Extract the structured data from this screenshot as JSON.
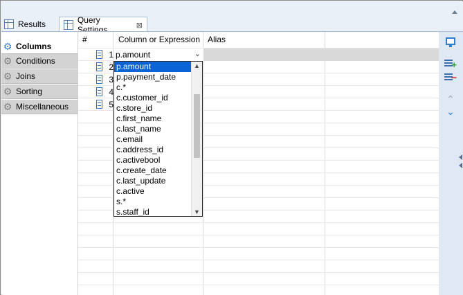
{
  "tabs": {
    "results_label": "Results",
    "query_settings_label": "Query Settings",
    "query_settings_close": "⊠"
  },
  "leftnav": {
    "items": [
      {
        "label": "Columns",
        "active": true
      },
      {
        "label": "Conditions",
        "active": false
      },
      {
        "label": "Joins",
        "active": false
      },
      {
        "label": "Sorting",
        "active": false
      },
      {
        "label": "Miscellaneous",
        "active": false
      }
    ]
  },
  "table": {
    "headers": {
      "num": "#",
      "column": "Column or Expression",
      "alias": "Alias"
    },
    "rows": [
      {
        "num": "1",
        "column": "p.amount",
        "alias": ""
      },
      {
        "num": "2",
        "column": "",
        "alias": ""
      },
      {
        "num": "3",
        "column": "",
        "alias": ""
      },
      {
        "num": "4",
        "column": "",
        "alias": ""
      },
      {
        "num": "5",
        "column": "",
        "alias": ""
      }
    ]
  },
  "dropdown": {
    "selected": "p.amount",
    "options": [
      "p.amount",
      "p.payment_date",
      "c.*",
      "c.customer_id",
      "c.store_id",
      "c.first_name",
      "c.last_name",
      "c.email",
      "c.address_id",
      "c.activebool",
      "c.create_date",
      "c.last_update",
      "c.active",
      "s.*",
      "s.staff_id"
    ]
  },
  "toolbar": {
    "icons": [
      "monitor-icon",
      "add-row-icon",
      "remove-row-icon",
      "move-up-icon",
      "move-down-icon"
    ]
  },
  "colors": {
    "selection": "#0a64d6",
    "accent": "#2f7fd1",
    "add": "#27a32b",
    "remove": "#d21e1e"
  }
}
